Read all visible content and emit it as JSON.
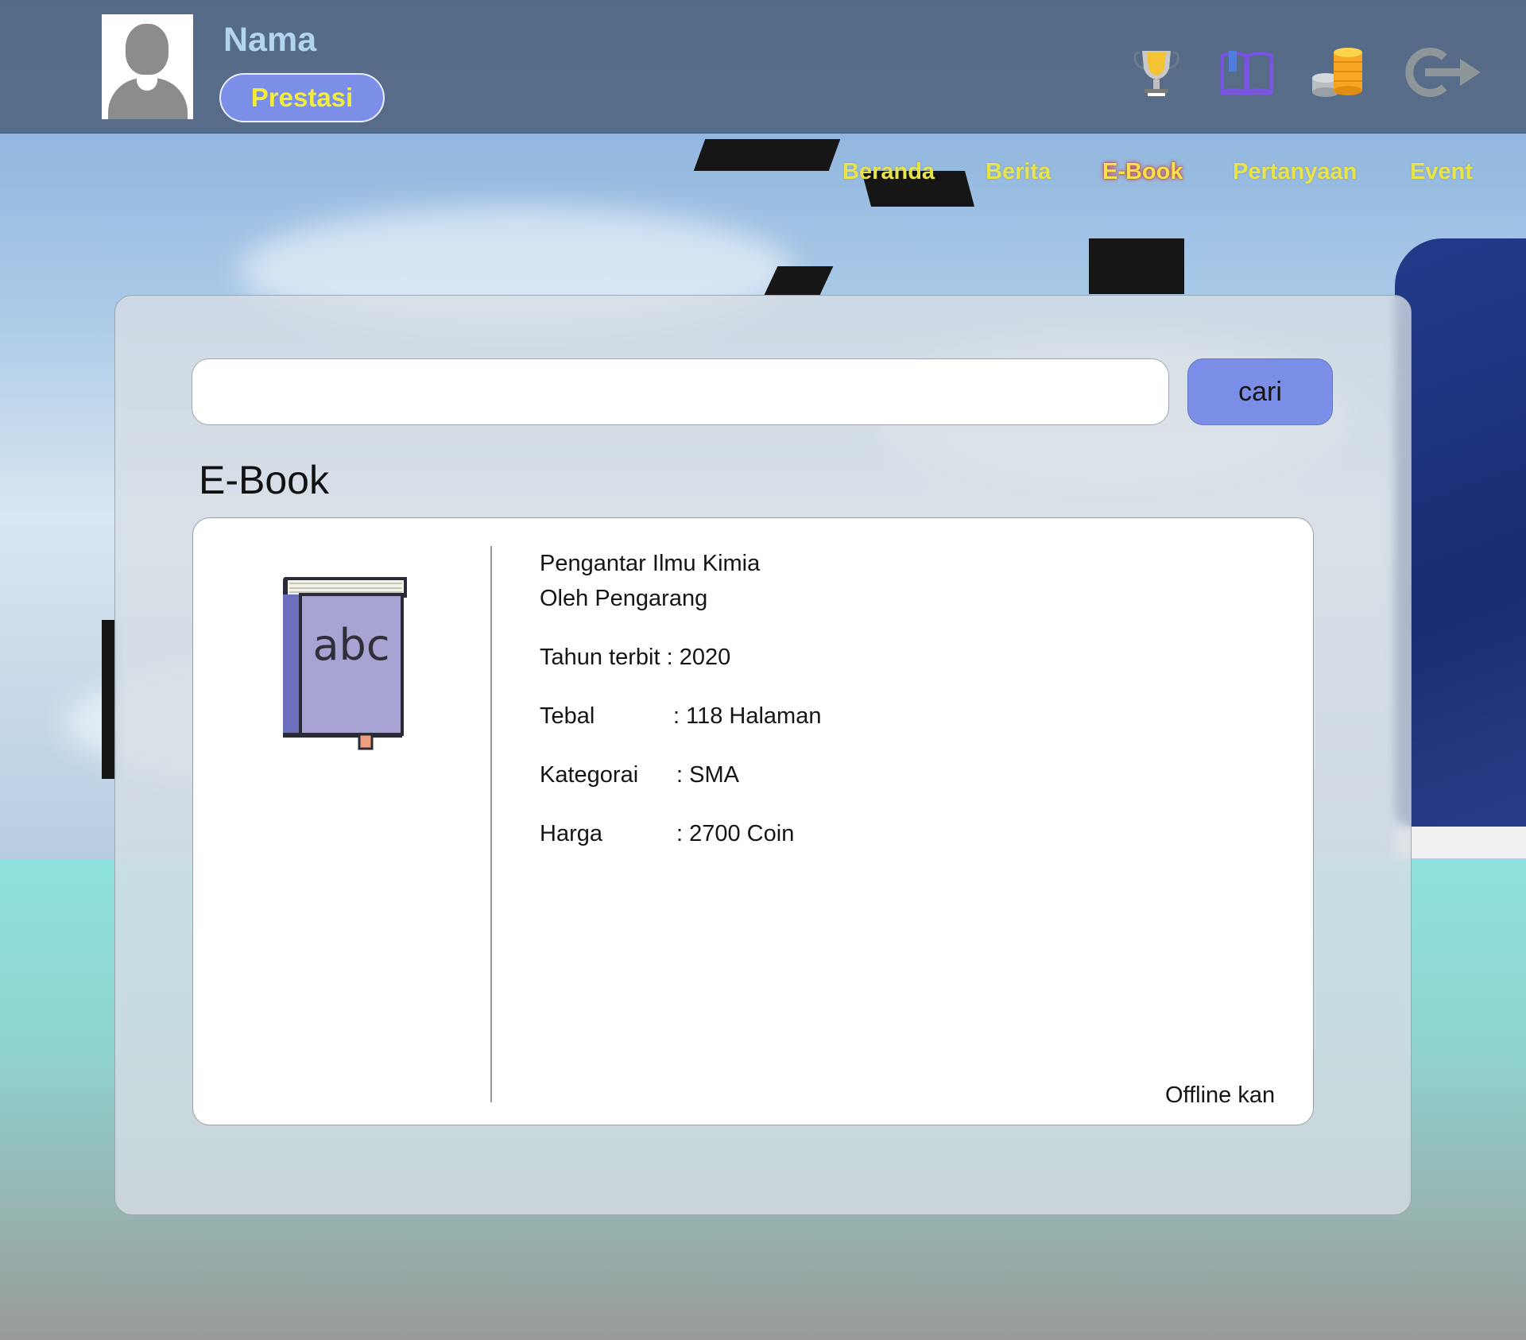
{
  "header": {
    "user_name": "Nama",
    "badge_label": "Prestasi",
    "icons": [
      "trophy-icon",
      "book-icon",
      "coins-icon",
      "logout-icon"
    ]
  },
  "nav": {
    "items": [
      {
        "label": "Beranda",
        "active": false
      },
      {
        "label": "Berita",
        "active": false
      },
      {
        "label": "E-Book",
        "active": true
      },
      {
        "label": "Pertanyaan",
        "active": false
      },
      {
        "label": "Event",
        "active": false
      }
    ]
  },
  "search": {
    "value": "",
    "placeholder": "",
    "button_label": "cari"
  },
  "section": {
    "title": "E-Book"
  },
  "ebook": {
    "cover_text": "abc",
    "title": "Pengantar Ilmu Kimia",
    "author_line": "Oleh Pengarang",
    "year_label": "Tahun terbit",
    "year_value": ": 2020",
    "pages_label": "Tebal",
    "pages_value": ": 118 Halaman",
    "category_label": "Kategorai",
    "category_value": ": SMA",
    "price_label": "Harga",
    "price_value": ": 2700 Coin",
    "action_label": "Offline kan"
  },
  "colors": {
    "accent": "#7b8fe9",
    "nav_text": "#e9e34a",
    "badge_text": "#f3ec3c",
    "name_text": "#b3d4f1",
    "header_bg": "#4e627c"
  }
}
